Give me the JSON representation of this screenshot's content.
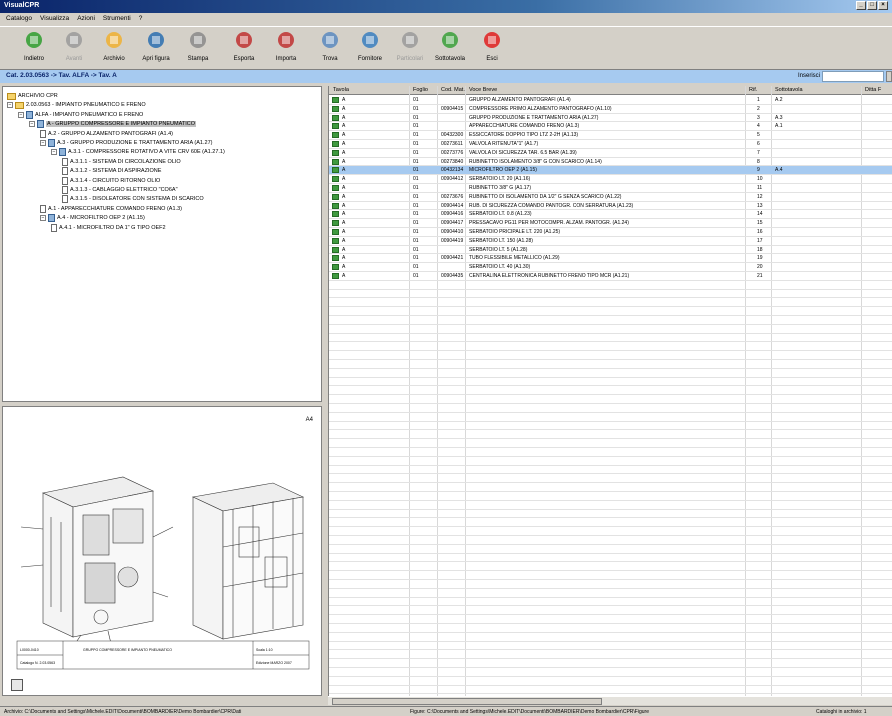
{
  "window": {
    "title": "VisualCPR"
  },
  "menu": [
    "Catalogo",
    "Visualizza",
    "Azioni",
    "Strumenti",
    "?"
  ],
  "toolbar": [
    {
      "label": "Indietro",
      "icon": "back-arrow-icon",
      "color": "#2e9e2e",
      "enabled": true
    },
    {
      "label": "Avanti",
      "icon": "forward-arrow-icon",
      "color": "#9a9a9a",
      "enabled": false
    },
    {
      "label": "Archivio",
      "icon": "archive-folder-icon",
      "color": "#f0b030",
      "enabled": true
    },
    {
      "label": "Apri figura",
      "icon": "picture-icon",
      "color": "#2a6fb0",
      "enabled": true
    },
    {
      "label": "Stampa",
      "icon": "printer-icon",
      "color": "#8a8a8a",
      "enabled": true
    },
    {
      "label": "Esporta",
      "icon": "export-icon",
      "color": "#c03030",
      "enabled": true
    },
    {
      "label": "Importa",
      "icon": "import-icon",
      "color": "#c03030",
      "enabled": true
    },
    {
      "label": "Trova",
      "icon": "magnifier-icon",
      "color": "#5a8ac0",
      "enabled": true
    },
    {
      "label": "Fornitore",
      "icon": "supplier-icon",
      "color": "#3a7fc0",
      "enabled": true
    },
    {
      "label": "Particolari",
      "icon": "parts-icon",
      "color": "#9a9a9a",
      "enabled": false
    },
    {
      "label": "Sottotavola",
      "icon": "subtable-icon",
      "color": "#3aa03a",
      "enabled": true
    },
    {
      "label": "Esci",
      "icon": "exit-icon",
      "color": "#e02020",
      "enabled": true
    }
  ],
  "breadcrumb": "Cat. 2.03.0563 -> Tav. ALFA -> Tav. A",
  "search": {
    "label": "Inserisci",
    "value": ""
  },
  "tree": [
    {
      "level": 0,
      "icon": "archive",
      "text": "ARCHIVIO CPR",
      "expander": "",
      "selected": false
    },
    {
      "level": 0,
      "icon": "folder",
      "text": "2.03.0563 - IMPIANTO PNEUMATICO E FRENO",
      "expander": "−",
      "selected": false
    },
    {
      "level": 1,
      "icon": "book",
      "text": "ALFA - IMPIANTO PNEUMATICO E FRENO",
      "expander": "−",
      "selected": false
    },
    {
      "level": 2,
      "icon": "book",
      "text": "A - GRUPPO COMPRESSORE E IMPIANTO PNEUMATICO",
      "expander": "−",
      "selected": true
    },
    {
      "level": 3,
      "icon": "file",
      "text": "A.2 - GRUPPO ALZAMENTO PANTOGRAFI (A1.4)",
      "expander": "",
      "selected": false
    },
    {
      "level": 3,
      "icon": "book",
      "text": "A.3 - GRUPPO PRODUZIONE E TRATTAMENTO ARIA (A1.27)",
      "expander": "−",
      "selected": false
    },
    {
      "level": 4,
      "icon": "book",
      "text": "A.3.1 - COMPRESSORE ROTATIVO A VITE CRV 60E (A1.27.1)",
      "expander": "−",
      "selected": false
    },
    {
      "level": 5,
      "icon": "file",
      "text": "A.3.1.1 - SISTEMA DI CIRCOLAZIONE OLIO",
      "expander": "",
      "selected": false
    },
    {
      "level": 5,
      "icon": "file",
      "text": "A.3.1.2 - SISTEMA DI ASPIRAZIONE",
      "expander": "",
      "selected": false
    },
    {
      "level": 5,
      "icon": "file",
      "text": "A.3.1.4 - CIRCUITO RITORNO OLIO",
      "expander": "",
      "selected": false
    },
    {
      "level": 5,
      "icon": "file",
      "text": "A.3.1.3 - CABLAGGIO ELETTRICO \"CO6A\"",
      "expander": "",
      "selected": false
    },
    {
      "level": 5,
      "icon": "file",
      "text": "A.3.1.5 - DISOLEATORE CON SISTEMA DI SCARICO",
      "expander": "",
      "selected": false
    },
    {
      "level": 3,
      "icon": "file",
      "text": "A.1 - APPARECCHIATURE COMANDO FRENO (A1.3)",
      "expander": "",
      "selected": false
    },
    {
      "level": 3,
      "icon": "book",
      "text": "A.4 - MICROFILTRO OEP 2 (A1.15)",
      "expander": "−",
      "selected": false
    },
    {
      "level": 4,
      "icon": "file",
      "text": "A.4.1 - MICROFILTRO DA 1\" G TIPO OEF2",
      "expander": "",
      "selected": false
    }
  ],
  "drawing": {
    "page_label": "A4",
    "title_block": [
      "L0000-0410",
      "GRUPPO COMPRESSORE E IMPIANTO PNEUMATICO",
      "Scala 1:10",
      "Catalogo N. 2.03.0563",
      "Edizione MARZO 2007"
    ]
  },
  "grid": {
    "columns": [
      "Tavola",
      "Foglio",
      "Cod. Mat.",
      "Voce Breve",
      "Rif.",
      "Sottotavola",
      "Ditta F"
    ],
    "rows": [
      [
        "A",
        "01",
        "",
        "GRUPPO ALZAMENTO PANTOGRAFI (A1.4)",
        "1",
        "A.2"
      ],
      [
        "A",
        "01",
        "00904415",
        "COMPRESSORE PRIMO ALZAMENTO PANTOGRAFO (A1.10)",
        "2",
        ""
      ],
      [
        "A",
        "01",
        "",
        "GRUPPO PRODUZIONE E TRATTAMENTO ARIA (A1.27)",
        "3",
        "A.3"
      ],
      [
        "A",
        "01",
        "",
        "APPARECCHIATURE COMANDO FRENO (A1.3)",
        "4",
        "A.1"
      ],
      [
        "A",
        "01",
        "00432300",
        "ESSICCATORE DOPPIO TIPO LTZ 2-2H (A1.13)",
        "5",
        ""
      ],
      [
        "A",
        "01",
        "00273611",
        "VALVOLA RITENUTA\"1\" (A1.7)",
        "6",
        ""
      ],
      [
        "A",
        "01",
        "00273776",
        "VALVOLA DI SICUREZZA TAR. 6.5 BAR (A1.39)",
        "7",
        ""
      ],
      [
        "A",
        "01",
        "00273840",
        "RUBINETTO ISOLAMENTO 3/8\" G CON SCARICO (A1.14)",
        "8",
        ""
      ],
      [
        "A",
        "01",
        "00432134",
        "MICROFILTRO OEP 2 (A1.15)",
        "9",
        "A.4"
      ],
      [
        "A",
        "01",
        "00904412",
        "SERBATOIO LT. 20 (A1.16)",
        "10",
        ""
      ],
      [
        "A",
        "01",
        "",
        "RUBINETTO 3/8\" G (A1.17)",
        "11",
        ""
      ],
      [
        "A",
        "01",
        "00273676",
        "RUBINETTO DI ISOLAMENTO DA 1/2\" G SENZA SCARICO (A1.22)",
        "12",
        ""
      ],
      [
        "A",
        "01",
        "00904414",
        "RUB. DI SICUREZZA COMANDO PANTOGR. CON SERRATURA (A1.23)",
        "13",
        ""
      ],
      [
        "A",
        "01",
        "00904416",
        "SERBATOIO LT. 0.8 (A1.23)",
        "14",
        ""
      ],
      [
        "A",
        "01",
        "00904417",
        "PRESSACAVO PG11 PER MOTOCOMPR. ALZAM. PANTOGR. (A1.24)",
        "15",
        ""
      ],
      [
        "A",
        "01",
        "00904410",
        "SERBATOIO PRICIPALE LT. 220 (A1.25)",
        "16",
        ""
      ],
      [
        "A",
        "01",
        "00904419",
        "SERBATOIO LT. 150 (A1.28)",
        "17",
        ""
      ],
      [
        "A",
        "01",
        "",
        "SERBATOIO LT. 5 (A1.28)",
        "18",
        ""
      ],
      [
        "A",
        "01",
        "00904421",
        "TUBO FLESSIBILE METALLICO (A1.29)",
        "19",
        ""
      ],
      [
        "A",
        "01",
        "",
        "SERBATOIO LT. 40 (A1.30)",
        "20",
        ""
      ],
      [
        "A",
        "01",
        "00904435",
        "CENTRALINA ELETTRONICA RUBINETTO FRENO TIPO MCR (A1.21)",
        "21",
        ""
      ]
    ],
    "selected_index": 8
  },
  "status": {
    "archive": "Archivio: C:\\Documents and Settings\\Michele.EDIT\\Documenti\\BOMBARDIER\\Demo Bombardier\\CPR\\Dati",
    "figure": "Figure: C:\\Documents and Settings\\Michele.EDIT\\Documenti\\BOMBARDIER\\Demo Bombardier\\CPR\\Figure",
    "catalogs": "Cataloghi in archivio: 1"
  }
}
